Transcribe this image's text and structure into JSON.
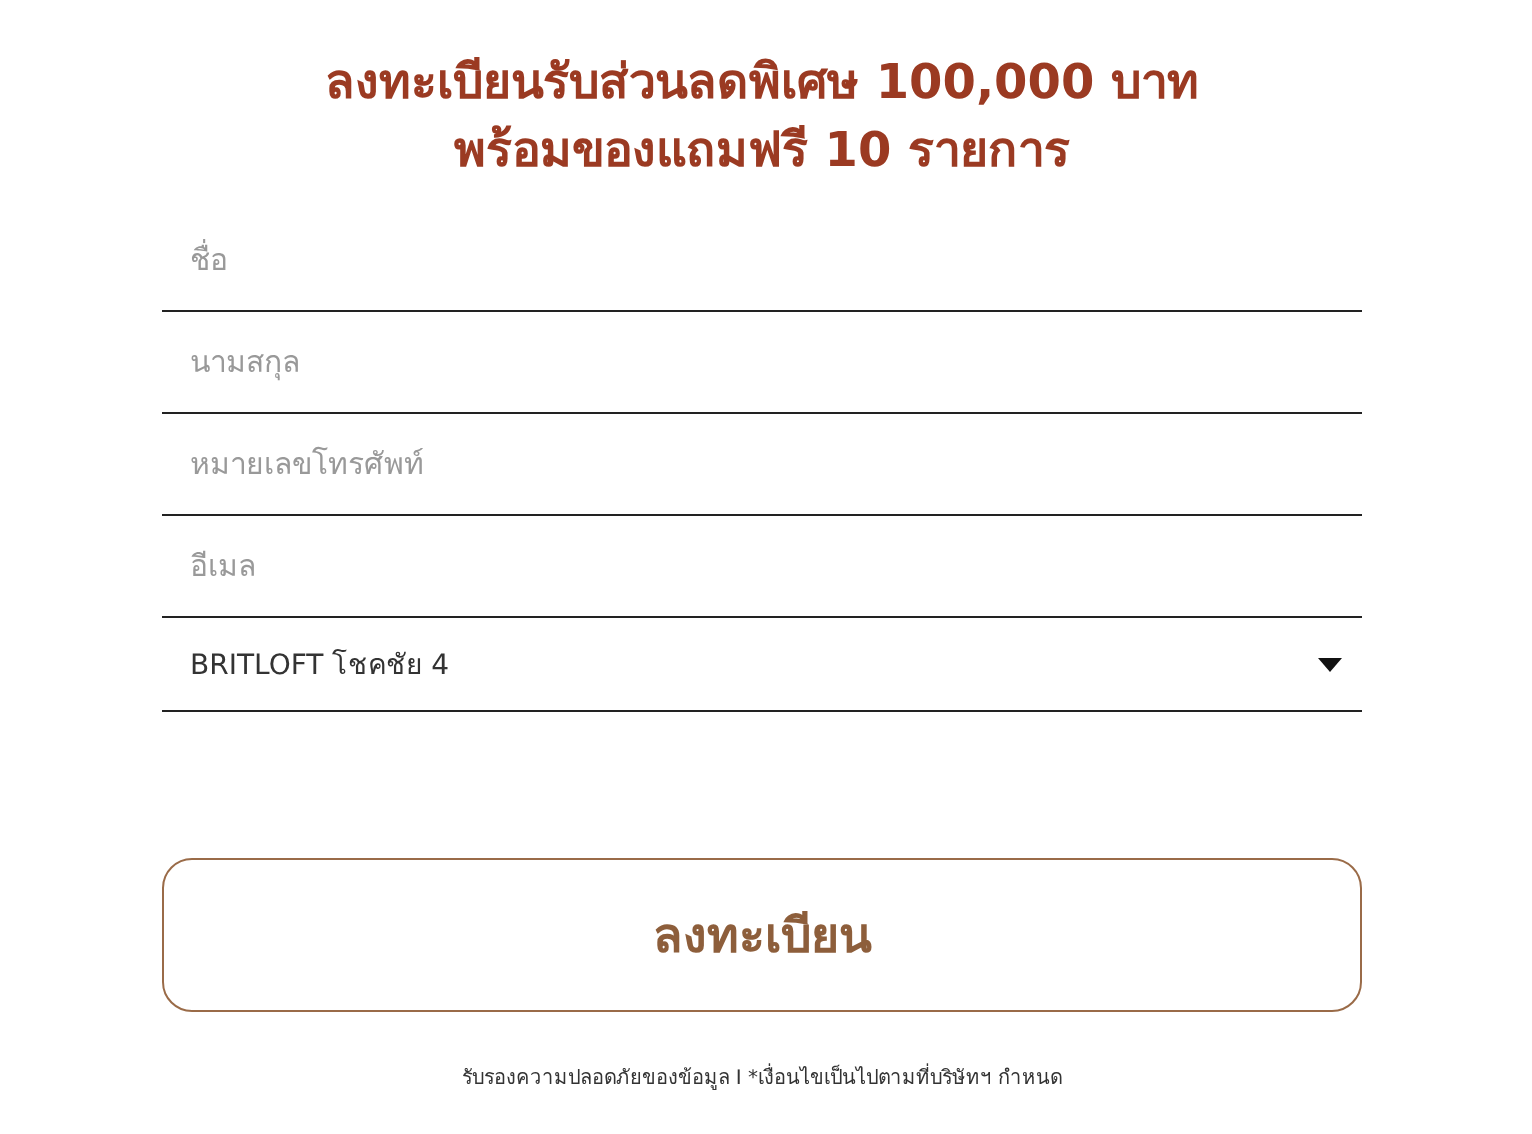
{
  "title_lines": [
    "ลงทะเบียนรับส่วนลดพิเศษ 100,000 บาท",
    "พร้อมของแถมฟรี 10 รายการ"
  ],
  "fields": [
    {
      "placeholder": "ชื่อ"
    },
    {
      "placeholder": "นามสกุล"
    },
    {
      "placeholder": "หมายเลขโทรศัพท์"
    },
    {
      "placeholder": "อีเมล"
    }
  ],
  "project_select": {
    "value": "BRITLOFT โชคชัย 4"
  },
  "submit_button": "ลงทะเบียน",
  "footer": "รับรองความปลอดภัยของข้อมูล I *เงื่อนไขเป็นไปตามที่บริษัทฯ กำหนด"
}
